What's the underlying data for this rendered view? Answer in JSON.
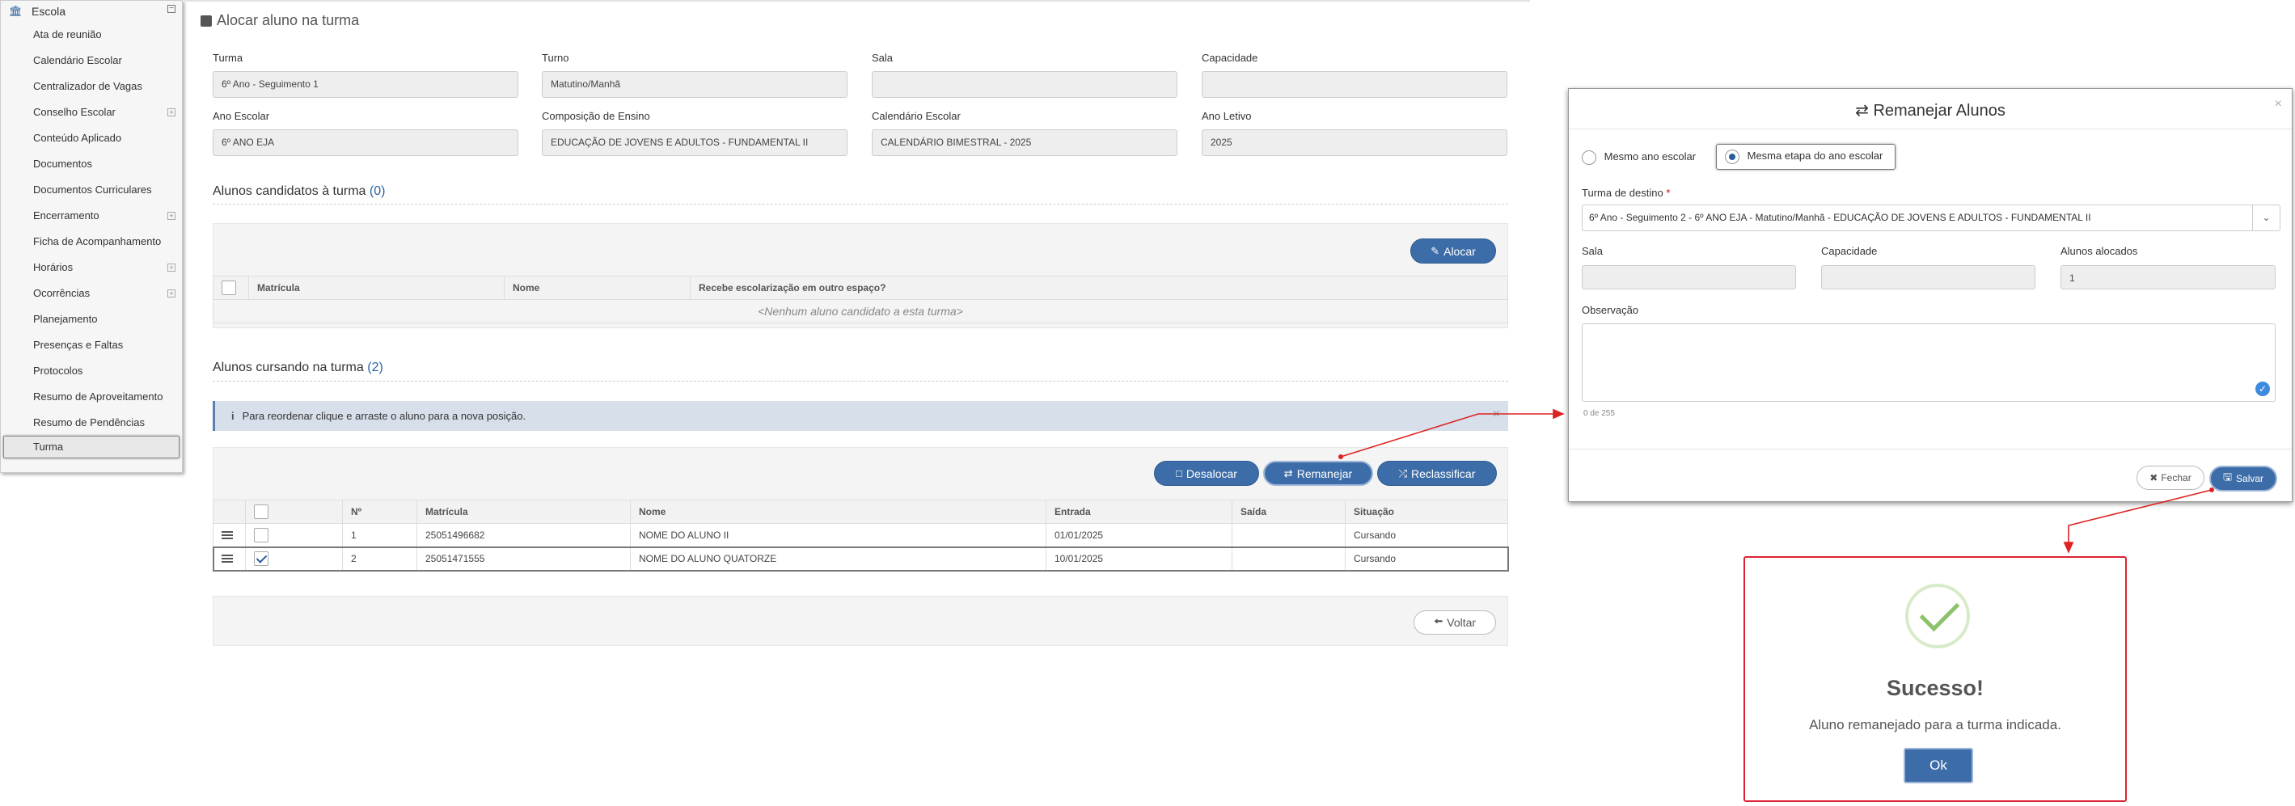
{
  "sidebar": {
    "header": "Escola",
    "items": [
      {
        "label": "Ata de reunião",
        "expandable": false
      },
      {
        "label": "Calendário Escolar",
        "expandable": false
      },
      {
        "label": "Centralizador de Vagas",
        "expandable": false
      },
      {
        "label": "Conselho Escolar",
        "expandable": true
      },
      {
        "label": "Conteúdo Aplicado",
        "expandable": false
      },
      {
        "label": "Documentos",
        "expandable": false
      },
      {
        "label": "Documentos Curriculares",
        "expandable": false
      },
      {
        "label": "Encerramento",
        "expandable": true
      },
      {
        "label": "Ficha de Acompanhamento",
        "expandable": false
      },
      {
        "label": "Horários",
        "expandable": true
      },
      {
        "label": "Ocorrências",
        "expandable": true
      },
      {
        "label": "Planejamento",
        "expandable": false
      },
      {
        "label": "Presenças e Faltas",
        "expandable": false
      },
      {
        "label": "Protocolos",
        "expandable": false
      },
      {
        "label": "Resumo de Aproveitamento",
        "expandable": false
      },
      {
        "label": "Resumo de Pendências",
        "expandable": false
      },
      {
        "label": "Turma",
        "expandable": false,
        "active": true
      }
    ]
  },
  "page": {
    "title": "Alocar aluno na turma",
    "fields": {
      "turma": {
        "label": "Turma",
        "value": "6º Ano - Seguimento 1"
      },
      "turno": {
        "label": "Turno",
        "value": "Matutino/Manhã"
      },
      "sala": {
        "label": "Sala",
        "value": ""
      },
      "capacidade": {
        "label": "Capacidade",
        "value": ""
      },
      "ano_escolar": {
        "label": "Ano Escolar",
        "value": "6º ANO EJA"
      },
      "composicao": {
        "label": "Composição de Ensino",
        "value": "EDUCAÇÃO DE JOVENS E ADULTOS - FUNDAMENTAL II"
      },
      "calendario": {
        "label": "Calendário Escolar",
        "value": "CALENDÁRIO BIMESTRAL - 2025"
      },
      "ano_letivo": {
        "label": "Ano Letivo",
        "value": "2025"
      }
    },
    "candidatos": {
      "title": "Alunos candidatos à turma",
      "count": "(0)",
      "alocar_label": "Alocar",
      "columns": [
        "Matrícula",
        "Nome",
        "Recebe escolarização em outro espaço?"
      ],
      "empty_text": "<Nenhum aluno candidato a esta turma>"
    },
    "cursando": {
      "title": "Alunos cursando na turma",
      "count": "(2)",
      "info": "Para reordenar clique e arraste o aluno para a nova posição.",
      "desalocar_label": "Desalocar",
      "remanejar_label": "Remanejar",
      "reclassificar_label": "Reclassificar",
      "columns": [
        "Nº",
        "Matrícula",
        "Nome",
        "Entrada",
        "Saída",
        "Situação"
      ],
      "rows": [
        {
          "num": "1",
          "matricula": "25051496682",
          "nome": "NOME DO ALUNO II",
          "entrada": "01/01/2025",
          "saida": "",
          "situacao": "Cursando",
          "checked": false
        },
        {
          "num": "2",
          "matricula": "25051471555",
          "nome": "NOME DO ALUNO QUATORZE",
          "entrada": "10/01/2025",
          "saida": "",
          "situacao": "Cursando",
          "checked": true
        }
      ]
    },
    "voltar_label": "Voltar"
  },
  "modal": {
    "title": "Remanejar Alunos",
    "radio_mesmo_ano": "Mesmo ano escolar",
    "radio_mesma_etapa": "Mesma etapa do ano escolar",
    "turma_destino_label": "Turma de destino",
    "turma_destino_value": "6º Ano - Seguimento 2 - 6º ANO EJA - Matutino/Manhã - EDUCAÇÃO DE JOVENS E ADULTOS - FUNDAMENTAL II",
    "sala_label": "Sala",
    "sala_value": "",
    "capacidade_label": "Capacidade",
    "capacidade_value": "",
    "alocados_label": "Alunos alocados",
    "alocados_value": "1",
    "observacao_label": "Observação",
    "observacao_counter": "0 de 255",
    "fechar_label": "Fechar",
    "salvar_label": "Salvar"
  },
  "success": {
    "title": "Sucesso!",
    "message": "Aluno remanejado para a turma indicada.",
    "ok_label": "Ok"
  },
  "colors": {
    "primary": "#3d6da8",
    "annotation": "#dd2222",
    "success_check": "#8cc26a"
  }
}
